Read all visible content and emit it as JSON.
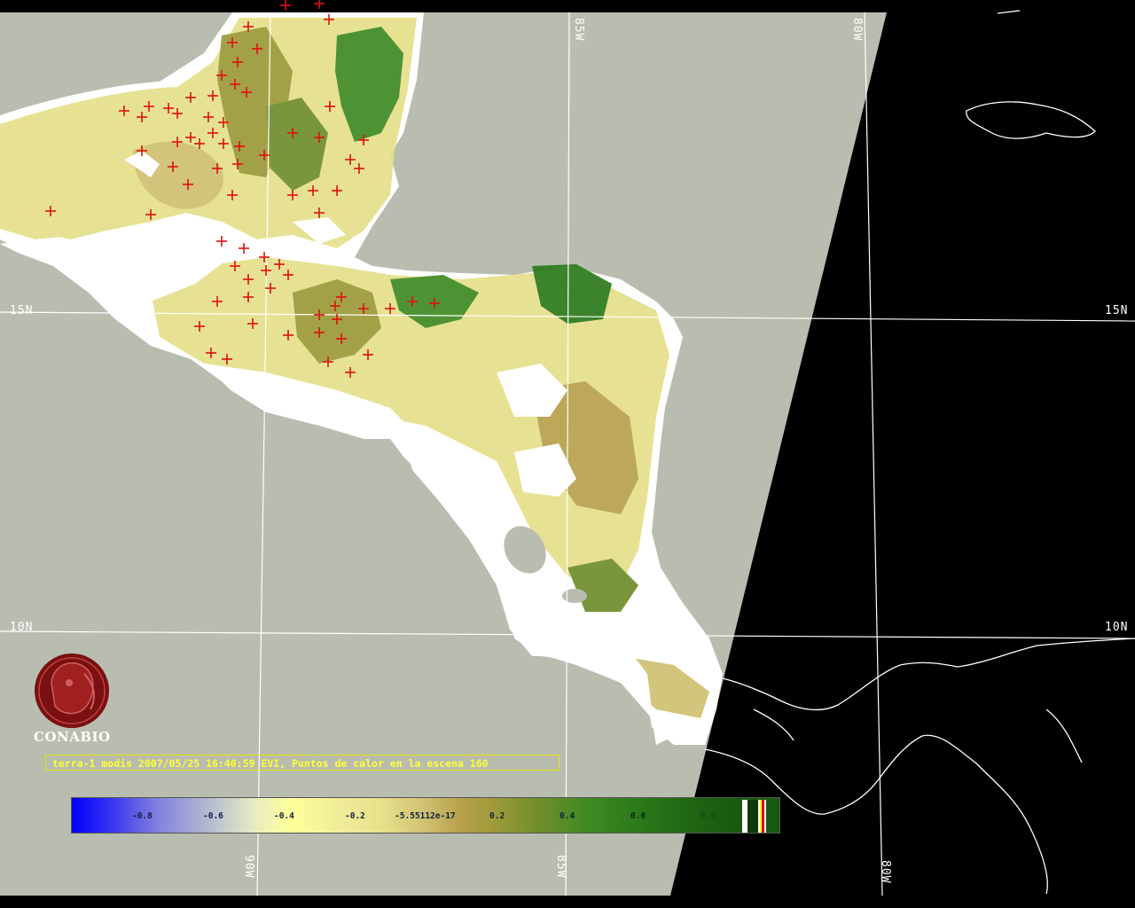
{
  "map": {
    "lat_labels": [
      {
        "side": "left",
        "text": "15N"
      },
      {
        "side": "right",
        "text": "15N"
      },
      {
        "side": "left",
        "text": "10N"
      },
      {
        "side": "right",
        "text": "10N"
      }
    ],
    "lon_labels_top": [
      "85W",
      "80W"
    ],
    "lon_labels_bottom": [
      "90W",
      "85W",
      "80W"
    ]
  },
  "logo": {
    "text": "CONABIO"
  },
  "caption": {
    "text": "terra-1 modis 2007/05/25 16:40:59 EVI, Puntos de calor en la escena 160"
  },
  "colorbar": {
    "ticks": [
      "-0.8",
      "-0.6",
      "-0.4",
      "-0.2",
      "-5.55112e-17",
      "0.2",
      "0.4",
      "0.6",
      "0.8"
    ]
  },
  "colors": {
    "background_space": "#000000",
    "ocean": "#b8bdb0",
    "land_cloud": "#ffffff",
    "vegetation_low": "#e6e08a",
    "vegetation_high": "#2b7a1a",
    "hotspot": "#e01010",
    "grid": "#ffffff",
    "caption": "#ffff33",
    "logo": "#7a1010"
  }
}
